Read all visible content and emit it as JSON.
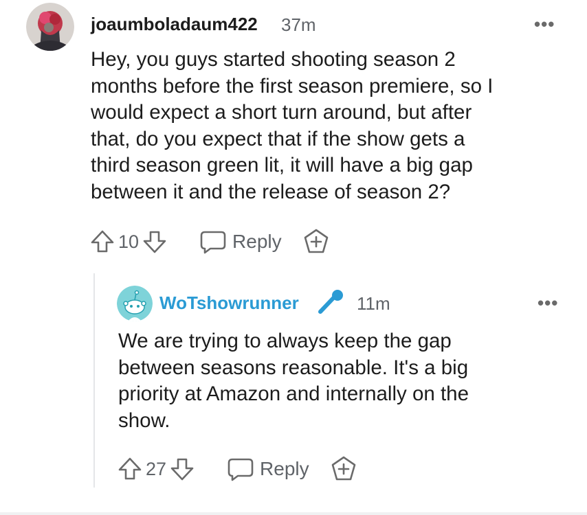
{
  "comments": [
    {
      "username": "joaumboladaum422",
      "time": "37m",
      "body": "Hey, you guys started shooting season 2\nmonths before the first season premiere, so I\nwould expect a short turn around, but after\nthat, do you expect that if the show gets a\nthird season green lit, it will have a big gap\nbetween it and the release of season 2?",
      "votes": "10",
      "reply_label": "Reply",
      "more": "•••"
    },
    {
      "username": "WoTshowrunner",
      "time": "11m",
      "body": "We are trying to always keep the gap\nbetween seasons reasonable. It's a big\npriority at Amazon and internally on the\nshow.",
      "votes": "27",
      "reply_label": "Reply",
      "more": "•••"
    }
  ],
  "colors": {
    "op_username": "#1c1c1c",
    "reply_username": "#2b9bd4",
    "mic_icon": "#2b9bd4",
    "meta_gray": "#5f6368"
  }
}
